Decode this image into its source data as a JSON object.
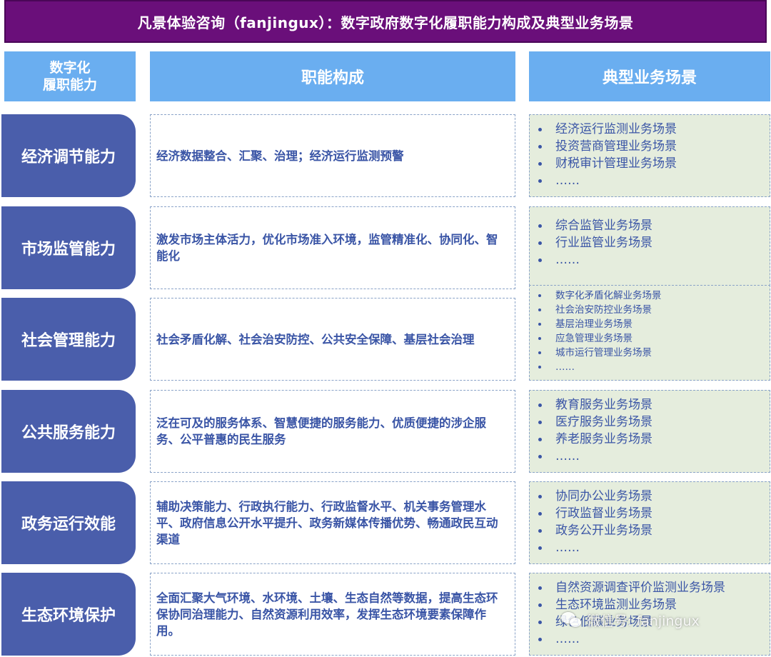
{
  "title": "凡景体验咨询（fanjingux）：数字政府数字化履职能力构成及典型业务场景",
  "headers": {
    "capability": "数字化\n履职能力",
    "function": "职能构成",
    "scenario": "典型业务场景"
  },
  "rows": [
    {
      "capability": "经济调节能力",
      "function": "经济数据整合、汇聚、治理；经济运行监测预警",
      "scenarios": [
        "经济运行监测业务场景",
        "投资营商管理业务场景",
        "财税审计管理业务场景",
        "……"
      ]
    },
    {
      "capability": "市场监管能力",
      "function": "激发市场主体活力，优化市场准入环境，监管精准化、协同化、智能化",
      "scenarios": [
        "综合监管业务场景",
        "行业监管业务场景",
        "……"
      ]
    },
    {
      "capability": "社会管理能力",
      "function": "社会矛盾化解、社会治安防控、公共安全保障、基层社会治理",
      "scenarios": [
        "数字化矛盾化解业务场景",
        "社会治安防控业务场景",
        "基层治理业务场景",
        "应急管理业务场景",
        "城市运行管理业务场景",
        "……"
      ]
    },
    {
      "capability": "公共服务能力",
      "function": "泛在可及的服务体系、智慧便捷的服务能力、优质便捷的涉企服务、公平普惠的民生服务",
      "scenarios": [
        "教育服务业务场景",
        "医疗服务业务场景",
        "养老服务业务场景",
        "……"
      ]
    },
    {
      "capability": "政务运行效能",
      "function": "辅助决策能力、行政执行能力、行政监督水平、机关事务管理水平、政府信息公开水平提升、政务新媒体传播优势、畅通政民互动渠道",
      "scenarios": [
        "协同办公业务场景",
        "行政监督业务场景",
        "政务公开业务场景",
        "……"
      ]
    },
    {
      "capability": "生态环境保护",
      "function": "全面汇聚大气环境、水环境、土壤、生态自然等数据，提高生态环保协同治理能力、自然资源利用效率，发挥生态环境要素保障作用。",
      "scenarios": [
        "自然资源调查评价监测业务场景",
        "生态环境监测业务场景",
        "绿色低碳业务场景",
        "……"
      ]
    }
  ],
  "watermark": "微信号: fanjingux",
  "colors": {
    "title_bg": "#6a0f7a",
    "header_bg": "#6aaef0",
    "capability_bg": "#4a5eab",
    "text_blue": "#3a55a6",
    "scenario_bg": "#e5eddd"
  }
}
